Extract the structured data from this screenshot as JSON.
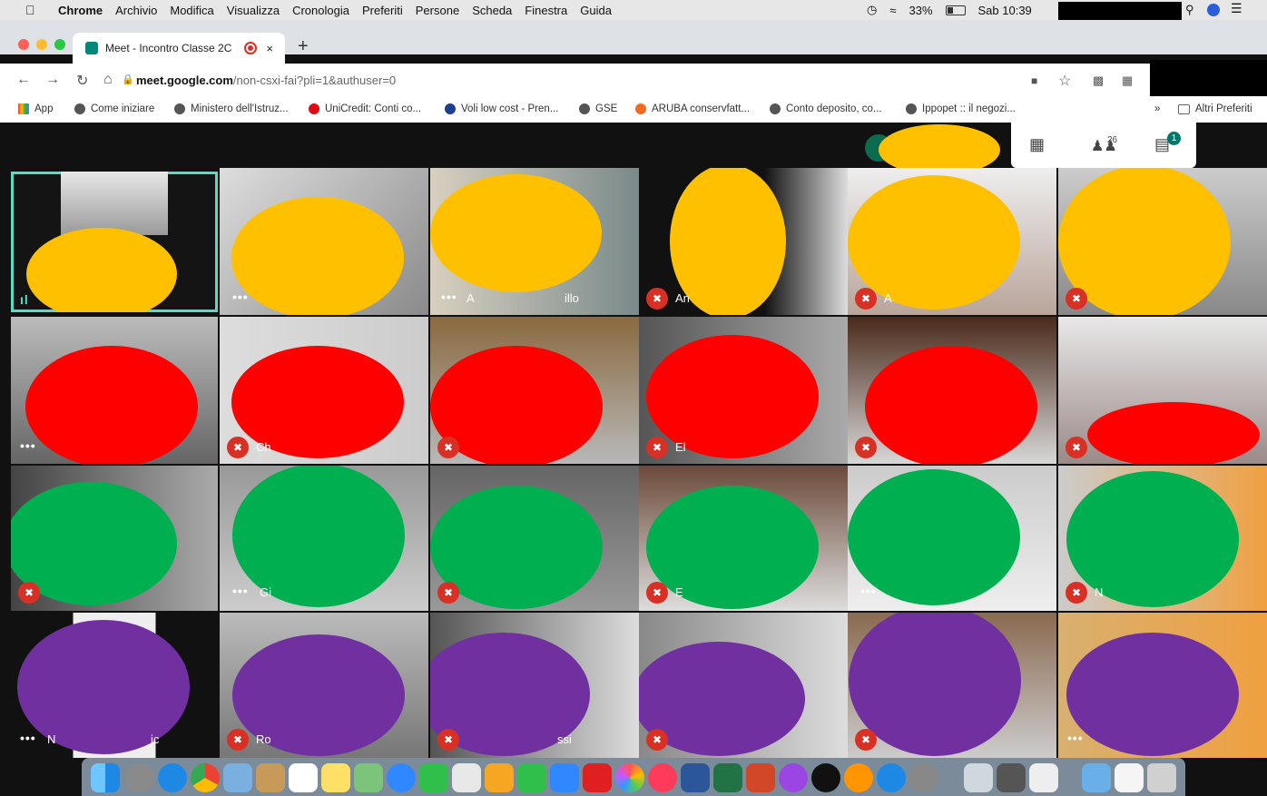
{
  "menubar": {
    "apple": "",
    "app": "Chrome",
    "items": [
      "Archivio",
      "Modifica",
      "Visualizza",
      "Cronologia",
      "Preferiti",
      "Persone",
      "Scheda",
      "Finestra",
      "Guida"
    ],
    "battery": "33%",
    "clock": "Sab 10:39"
  },
  "tab": {
    "title": "Meet - Incontro Classe 2C",
    "close": "×"
  },
  "newtab": "+",
  "toolbar": {
    "url_host": "meet.google.com",
    "url_path": "/non-csxi-fai?pli=1&authuser=0"
  },
  "bookmarks": [
    {
      "label": "App"
    },
    {
      "label": "Come iniziare"
    },
    {
      "label": "Ministero dell'Istruz..."
    },
    {
      "label": "UniCredit: Conti co..."
    },
    {
      "label": "Voli low cost - Pren..."
    },
    {
      "label": "GSE"
    },
    {
      "label": "ARUBA conservfatt..."
    },
    {
      "label": "Conto deposito, co..."
    },
    {
      "label": "Ippopet :: il negozi..."
    }
  ],
  "bookmarks_more": "»",
  "bookmarks_other": "Altri Preferiti",
  "meet": {
    "participants_count": "26",
    "chat_badge": "1"
  },
  "participants": [
    {
      "name": ""
    },
    {
      "name": ""
    },
    {
      "name": "A",
      "name_end": "illo"
    },
    {
      "name": "An"
    },
    {
      "name": "A"
    },
    {
      "name": ""
    },
    {
      "name": ""
    },
    {
      "name": "Ch"
    },
    {
      "name": ""
    },
    {
      "name": "El"
    },
    {
      "name": ""
    },
    {
      "name": ""
    },
    {
      "name": ""
    },
    {
      "name": "Gi"
    },
    {
      "name": ""
    },
    {
      "name": "E"
    },
    {
      "name": ""
    },
    {
      "name": "N"
    },
    {
      "name": "N",
      "name_end": "ic"
    },
    {
      "name": "Ro"
    },
    {
      "name": "",
      "name_end": "ssi"
    },
    {
      "name": ""
    },
    {
      "name": ""
    },
    {
      "name": ""
    }
  ],
  "colors": {
    "row1": "#ffc000",
    "row2": "#ff0000",
    "row3": "#00b050",
    "row4": "#7030a0",
    "active_border": "#4ee0c8",
    "mute": "#d93025"
  }
}
